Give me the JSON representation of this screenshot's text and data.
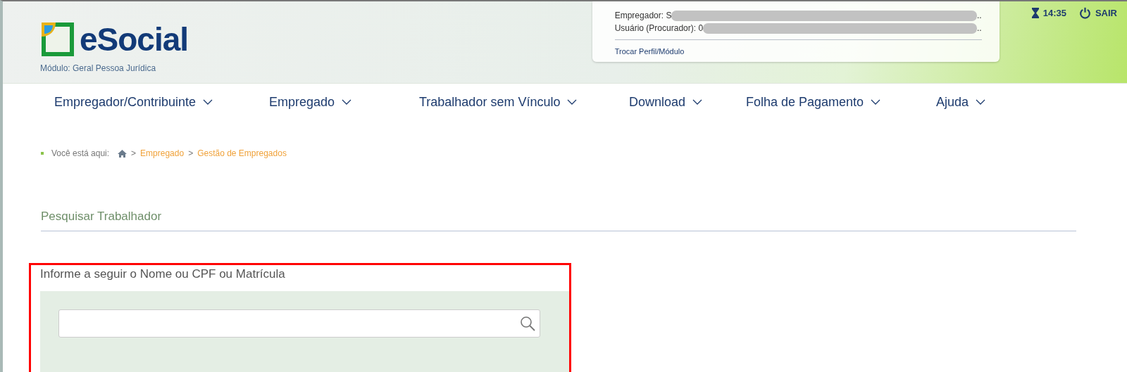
{
  "header": {
    "logo_text": "eSocial",
    "module": "Módulo: Geral Pessoa Jurídica",
    "user_card": {
      "lines": [
        {
          "label": "Empregador: S",
          "ellipsis": ".."
        },
        {
          "label": "Usuário (Procurador): 0",
          "ellipsis": ".."
        }
      ],
      "link": "Trocar Perfil/Módulo"
    },
    "session_time": "14:35",
    "logout": "SAIR"
  },
  "nav": [
    {
      "label": "Empregador/Contribuinte"
    },
    {
      "label": "Empregado"
    },
    {
      "label": "Trabalhador sem Vínculo"
    },
    {
      "label": "Download"
    },
    {
      "label": "Folha de Pagamento"
    },
    {
      "label": "Ajuda"
    }
  ],
  "breadcrumb": {
    "prefix": "Você está aqui:",
    "separator": ">",
    "items": [
      "Empregado",
      "Gestão de Empregados"
    ]
  },
  "section_title": "Pesquisar Trabalhador",
  "search": {
    "label": "Informe a seguir o Nome ou CPF ou Matrícula",
    "highlighted": true
  }
}
